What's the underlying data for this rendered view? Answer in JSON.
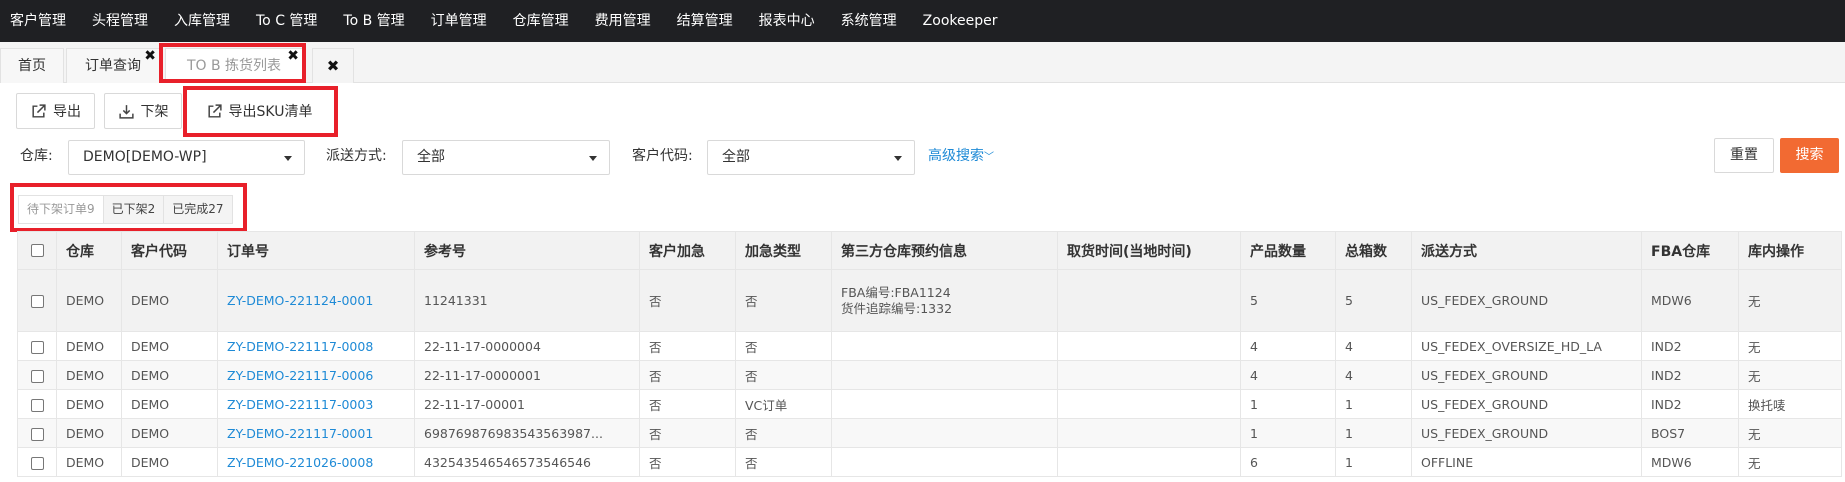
{
  "nav": {
    "items": [
      "客户管理",
      "头程管理",
      "入库管理",
      "To C 管理",
      "To B 管理",
      "订单管理",
      "仓库管理",
      "费用管理",
      "结算管理",
      "报表中心",
      "系统管理",
      "Zookeeper"
    ]
  },
  "tabs": [
    {
      "label": "首页",
      "closable": false,
      "active": false
    },
    {
      "label": "订单查询",
      "closable": true,
      "active": false
    },
    {
      "label": "TO B 拣货列表",
      "closable": true,
      "active": true
    }
  ],
  "toolbar": {
    "export_label": "导出",
    "shelve_label": "下架",
    "export_sku_label": "导出SKU清单"
  },
  "filters": {
    "warehouse_label": "仓库:",
    "warehouse_value": "DEMO[DEMO-WP]",
    "delivery_label": "派送方式:",
    "delivery_value": "全部",
    "customer_label": "客户代码:",
    "customer_value": "全部",
    "advanced_search": "高级搜索",
    "reset_label": "重置",
    "search_label": "搜索"
  },
  "status_tabs": [
    "待下架订单9",
    "已下架2",
    "已完成27"
  ],
  "table": {
    "headers": [
      "仓库",
      "客户代码",
      "订单号",
      "参考号",
      "客户加急",
      "加急类型",
      "第三方仓库预约信息",
      "取货时间(当地时间)",
      "产品数量",
      "总箱数",
      "派送方式",
      "FBA仓库",
      "库内操作"
    ],
    "rows": [
      {
        "warehouse": "DEMO",
        "customer": "DEMO",
        "order_no": "ZY-DEMO-221124-0001",
        "ref_no": "11241331",
        "urgent": "否",
        "urgent_type": "否",
        "third_party_line1": "FBA编号:FBA1124",
        "third_party_line2": "货件追踪编号:1332",
        "pickup_time": "",
        "qty": "5",
        "boxes": "5",
        "delivery": "US_FEDEX_GROUND",
        "fba_wh": "MDW6",
        "op": "无"
      },
      {
        "warehouse": "DEMO",
        "customer": "DEMO",
        "order_no": "ZY-DEMO-221117-0008",
        "ref_no": "22-11-17-0000004",
        "urgent": "否",
        "urgent_type": "否",
        "third_party_line1": "",
        "third_party_line2": "",
        "pickup_time": "",
        "qty": "4",
        "boxes": "4",
        "delivery": "US_FEDEX_OVERSIZE_HD_LA",
        "fba_wh": "IND2",
        "op": "无"
      },
      {
        "warehouse": "DEMO",
        "customer": "DEMO",
        "order_no": "ZY-DEMO-221117-0006",
        "ref_no": "22-11-17-0000001",
        "urgent": "否",
        "urgent_type": "否",
        "third_party_line1": "",
        "third_party_line2": "",
        "pickup_time": "",
        "qty": "4",
        "boxes": "4",
        "delivery": "US_FEDEX_GROUND",
        "fba_wh": "IND2",
        "op": "无"
      },
      {
        "warehouse": "DEMO",
        "customer": "DEMO",
        "order_no": "ZY-DEMO-221117-0003",
        "ref_no": "22-11-17-00001",
        "urgent": "否",
        "urgent_type": "VC订单",
        "third_party_line1": "",
        "third_party_line2": "",
        "pickup_time": "",
        "qty": "1",
        "boxes": "1",
        "delivery": "US_FEDEX_GROUND",
        "fba_wh": "IND2",
        "op": "换托唛"
      },
      {
        "warehouse": "DEMO",
        "customer": "DEMO",
        "order_no": "ZY-DEMO-221117-0001",
        "ref_no": "698769876983543563987...",
        "urgent": "否",
        "urgent_type": "否",
        "third_party_line1": "",
        "third_party_line2": "",
        "pickup_time": "",
        "qty": "1",
        "boxes": "1",
        "delivery": "US_FEDEX_GROUND",
        "fba_wh": "BOS7",
        "op": "无"
      },
      {
        "warehouse": "DEMO",
        "customer": "DEMO",
        "order_no": "ZY-DEMO-221026-0008",
        "ref_no": "432543546546573546546",
        "urgent": "否",
        "urgent_type": "否",
        "third_party_line1": "",
        "third_party_line2": "",
        "pickup_time": "",
        "qty": "6",
        "boxes": "1",
        "delivery": "OFFLINE",
        "fba_wh": "MDW6",
        "op": "无"
      }
    ]
  },
  "colors": {
    "topnav_bg": "#1f2023",
    "link": "#1e8ad6",
    "search_button": "#f26a32",
    "highlight_box": "#e8202a"
  }
}
